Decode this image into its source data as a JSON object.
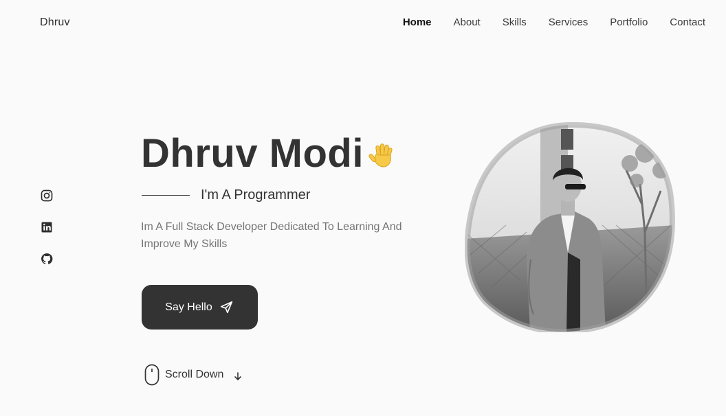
{
  "header": {
    "logo": "Dhruv",
    "nav": [
      {
        "label": "Home",
        "active": true
      },
      {
        "label": "About",
        "active": false
      },
      {
        "label": "Skills",
        "active": false
      },
      {
        "label": "Services",
        "active": false
      },
      {
        "label": "Portfolio",
        "active": false
      },
      {
        "label": "Contact",
        "active": false
      }
    ]
  },
  "socials": [
    {
      "icon": "instagram-icon"
    },
    {
      "icon": "linkedin-icon"
    },
    {
      "icon": "github-icon"
    }
  ],
  "hero": {
    "name": "Dhruv Modi",
    "subtitle": "I'm A Programmer",
    "description": "Im A Full Stack Developer Dedicated To Learning And Improve My Skills",
    "cta_label": "Say Hello",
    "scroll_label": "Scroll Down"
  },
  "colors": {
    "background": "#fafafa",
    "text": "#333333",
    "muted": "#757575",
    "button_bg": "#333333",
    "button_text": "#ffffff",
    "hand_emoji": "#f7c948"
  }
}
